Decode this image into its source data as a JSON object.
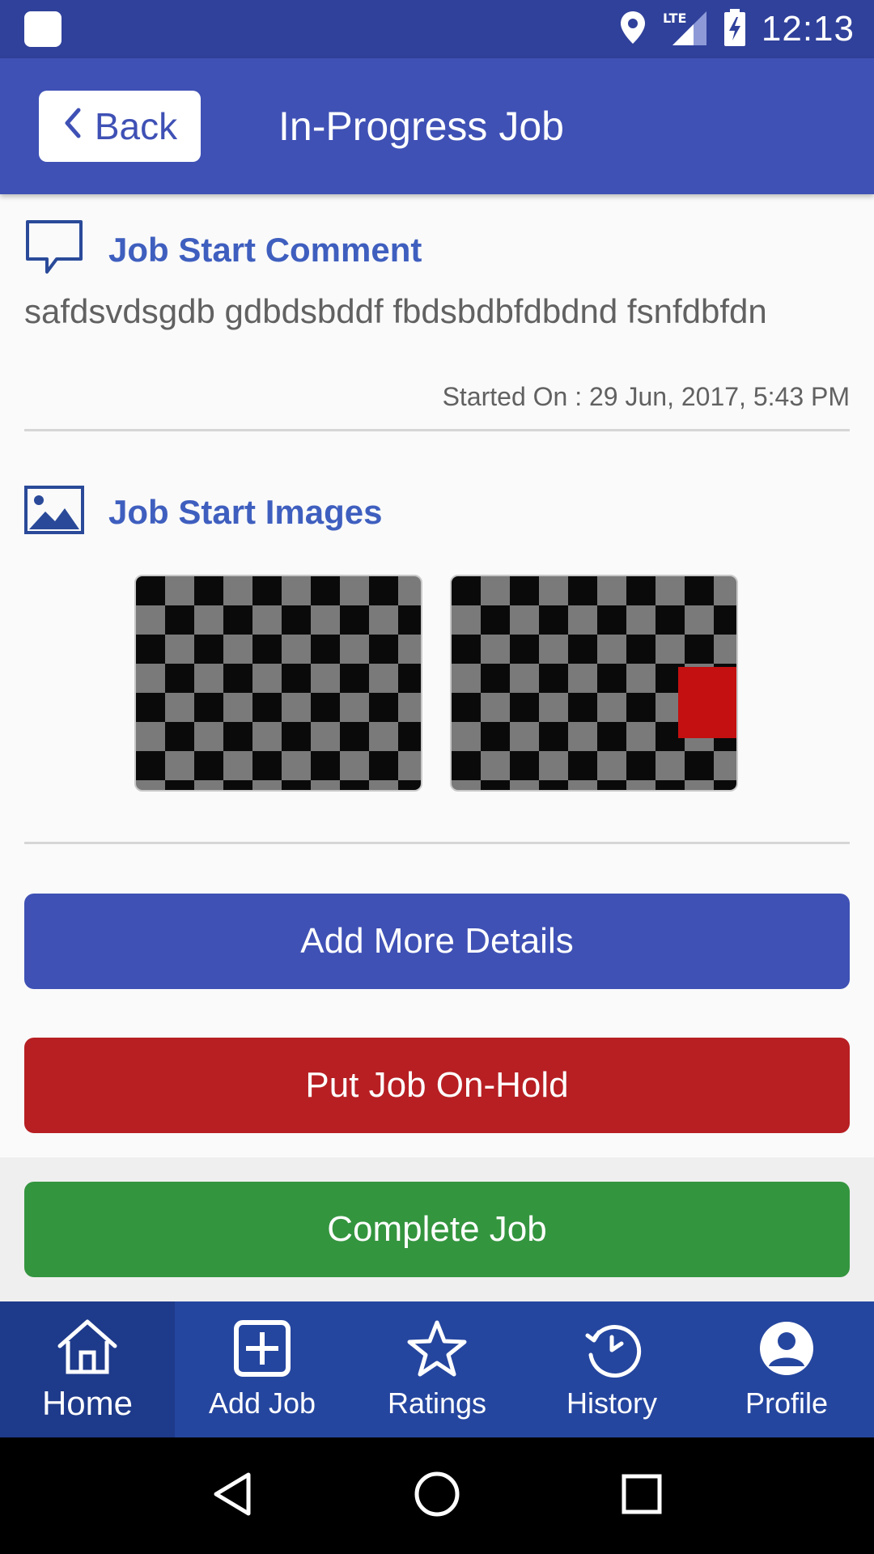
{
  "status_bar": {
    "time": "12:13",
    "network": "LTE",
    "icons": [
      "app-notification-icon",
      "location-pin-icon",
      "lte-signal-icon",
      "battery-charging-icon"
    ]
  },
  "app_bar": {
    "back_label": "Back",
    "title": "In-Progress Job"
  },
  "comment_section": {
    "title": "Job Start Comment",
    "text": "safdsvdsgdb gdbdsbddf fbdsbdbfdbdnd fsnfdbfdn",
    "started_on": "Started On : 29 Jun, 2017, 5:43 PM"
  },
  "images_section": {
    "title": "Job Start Images"
  },
  "actions": {
    "add_more_details": "Add More Details",
    "put_on_hold": "Put Job On-Hold",
    "complete_job": "Complete Job"
  },
  "colors": {
    "primary": "#3f51b5",
    "danger": "#b71f23",
    "success": "#34953f",
    "nav_background": "#25469f"
  },
  "bottom_nav": {
    "items": [
      {
        "label": "Home",
        "icon": "home-icon",
        "active": true
      },
      {
        "label": "Add Job",
        "icon": "add-box-icon",
        "active": false
      },
      {
        "label": "Ratings",
        "icon": "star-icon",
        "active": false
      },
      {
        "label": "History",
        "icon": "history-icon",
        "active": false
      },
      {
        "label": "Profile",
        "icon": "profile-icon",
        "active": false
      }
    ]
  }
}
